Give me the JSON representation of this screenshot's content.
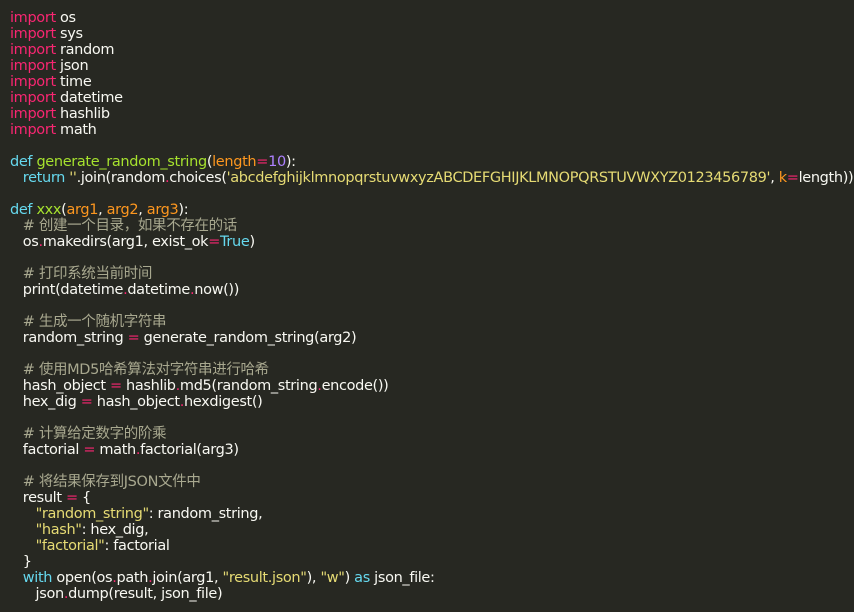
{
  "colors": {
    "background": "#272822",
    "plain": "#f8f8f2",
    "keyword": "#f92672",
    "storage": "#66d9ef",
    "function": "#a6e22e",
    "param": "#fd971f",
    "number": "#ae81ff",
    "string": "#e6db74",
    "comment": "#a8a88f"
  },
  "code": {
    "lines": [
      [
        [
          "kw",
          "import"
        ],
        [
          "pl",
          " os"
        ]
      ],
      [
        [
          "kw",
          "import"
        ],
        [
          "pl",
          " sys"
        ]
      ],
      [
        [
          "kw",
          "import"
        ],
        [
          "pl",
          " random"
        ]
      ],
      [
        [
          "kw",
          "import"
        ],
        [
          "pl",
          " json"
        ]
      ],
      [
        [
          "kw",
          "import"
        ],
        [
          "pl",
          " time"
        ]
      ],
      [
        [
          "kw",
          "import"
        ],
        [
          "pl",
          " datetime"
        ]
      ],
      [
        [
          "kw",
          "import"
        ],
        [
          "pl",
          " hashlib"
        ]
      ],
      [
        [
          "kw",
          "import"
        ],
        [
          "pl",
          " math"
        ]
      ],
      [],
      [
        [
          "st",
          "def"
        ],
        [
          "pl",
          " "
        ],
        [
          "fn",
          "generate_random_string"
        ],
        [
          "pl",
          "("
        ],
        [
          "pa",
          "length"
        ],
        [
          "op",
          "="
        ],
        [
          "num",
          "10"
        ],
        [
          "pl",
          "):"
        ]
      ],
      [
        [
          "pl",
          "   "
        ],
        [
          "st",
          "return"
        ],
        [
          "pl",
          " "
        ],
        [
          "str",
          "''"
        ],
        [
          "pl",
          ".join(random"
        ],
        [
          "op",
          "."
        ],
        [
          "pl",
          "choices("
        ],
        [
          "str",
          "'abcdefghijklmnopqrstuvwxyzABCDEFGHIJKLMNOPQRSTUVWXYZ0123456789'"
        ],
        [
          "pl",
          ", "
        ],
        [
          "pa",
          "k"
        ],
        [
          "op",
          "="
        ],
        [
          "pl",
          "length))"
        ]
      ],
      [],
      [
        [
          "st",
          "def"
        ],
        [
          "pl",
          " "
        ],
        [
          "fn",
          "xxx"
        ],
        [
          "pl",
          "("
        ],
        [
          "pa",
          "arg1"
        ],
        [
          "pl",
          ", "
        ],
        [
          "pa",
          "arg2"
        ],
        [
          "pl",
          ", "
        ],
        [
          "pa",
          "arg3"
        ],
        [
          "pl",
          "):"
        ]
      ],
      [
        [
          "pl",
          "   "
        ],
        [
          "cm",
          "# 创建一个目录，如果不存在的话"
        ]
      ],
      [
        [
          "pl",
          "   os"
        ],
        [
          "op",
          "."
        ],
        [
          "pl",
          "makedirs(arg1, exist_ok"
        ],
        [
          "op",
          "="
        ],
        [
          "bi",
          "True"
        ],
        [
          "pl",
          ")"
        ]
      ],
      [],
      [
        [
          "pl",
          "   "
        ],
        [
          "cm",
          "# 打印系统当前时间"
        ]
      ],
      [
        [
          "pl",
          "   print(datetime"
        ],
        [
          "op",
          "."
        ],
        [
          "pl",
          "datetime"
        ],
        [
          "op",
          "."
        ],
        [
          "pl",
          "now())"
        ]
      ],
      [],
      [
        [
          "pl",
          "   "
        ],
        [
          "cm",
          "# 生成一个随机字符串"
        ]
      ],
      [
        [
          "pl",
          "   random_string "
        ],
        [
          "op",
          "="
        ],
        [
          "pl",
          " generate_random_string(arg2)"
        ]
      ],
      [],
      [
        [
          "pl",
          "   "
        ],
        [
          "cm",
          "# 使用MD5哈希算法对字符串进行哈希"
        ]
      ],
      [
        [
          "pl",
          "   hash_object "
        ],
        [
          "op",
          "="
        ],
        [
          "pl",
          " hashlib"
        ],
        [
          "op",
          "."
        ],
        [
          "pl",
          "md5(random_string"
        ],
        [
          "op",
          "."
        ],
        [
          "pl",
          "encode())"
        ]
      ],
      [
        [
          "pl",
          "   hex_dig "
        ],
        [
          "op",
          "="
        ],
        [
          "pl",
          " hash_object"
        ],
        [
          "op",
          "."
        ],
        [
          "pl",
          "hexdigest()"
        ]
      ],
      [],
      [
        [
          "pl",
          "   "
        ],
        [
          "cm",
          "# 计算给定数字的阶乘"
        ]
      ],
      [
        [
          "pl",
          "   factorial "
        ],
        [
          "op",
          "="
        ],
        [
          "pl",
          " math"
        ],
        [
          "op",
          "."
        ],
        [
          "pl",
          "factorial(arg3)"
        ]
      ],
      [],
      [
        [
          "pl",
          "   "
        ],
        [
          "cm",
          "# 将结果保存到JSON文件中"
        ]
      ],
      [
        [
          "pl",
          "   result "
        ],
        [
          "op",
          "="
        ],
        [
          "pl",
          " {"
        ]
      ],
      [
        [
          "pl",
          "      "
        ],
        [
          "str",
          "\"random_string\""
        ],
        [
          "pl",
          ": random_string,"
        ]
      ],
      [
        [
          "pl",
          "      "
        ],
        [
          "str",
          "\"hash\""
        ],
        [
          "pl",
          ": hex_dig,"
        ]
      ],
      [
        [
          "pl",
          "      "
        ],
        [
          "str",
          "\"factorial\""
        ],
        [
          "pl",
          ": factorial"
        ]
      ],
      [
        [
          "pl",
          "   }"
        ]
      ],
      [
        [
          "pl",
          "   "
        ],
        [
          "st",
          "with"
        ],
        [
          "pl",
          " open(os"
        ],
        [
          "op",
          "."
        ],
        [
          "pl",
          "path"
        ],
        [
          "op",
          "."
        ],
        [
          "pl",
          "join(arg1, "
        ],
        [
          "str",
          "\"result.json\""
        ],
        [
          "pl",
          "), "
        ],
        [
          "str",
          "\"w\""
        ],
        [
          "pl",
          ") "
        ],
        [
          "st",
          "as"
        ],
        [
          "pl",
          " json_file:"
        ]
      ],
      [
        [
          "pl",
          "      json"
        ],
        [
          "op",
          "."
        ],
        [
          "pl",
          "dump(result, json_file)"
        ]
      ]
    ]
  }
}
